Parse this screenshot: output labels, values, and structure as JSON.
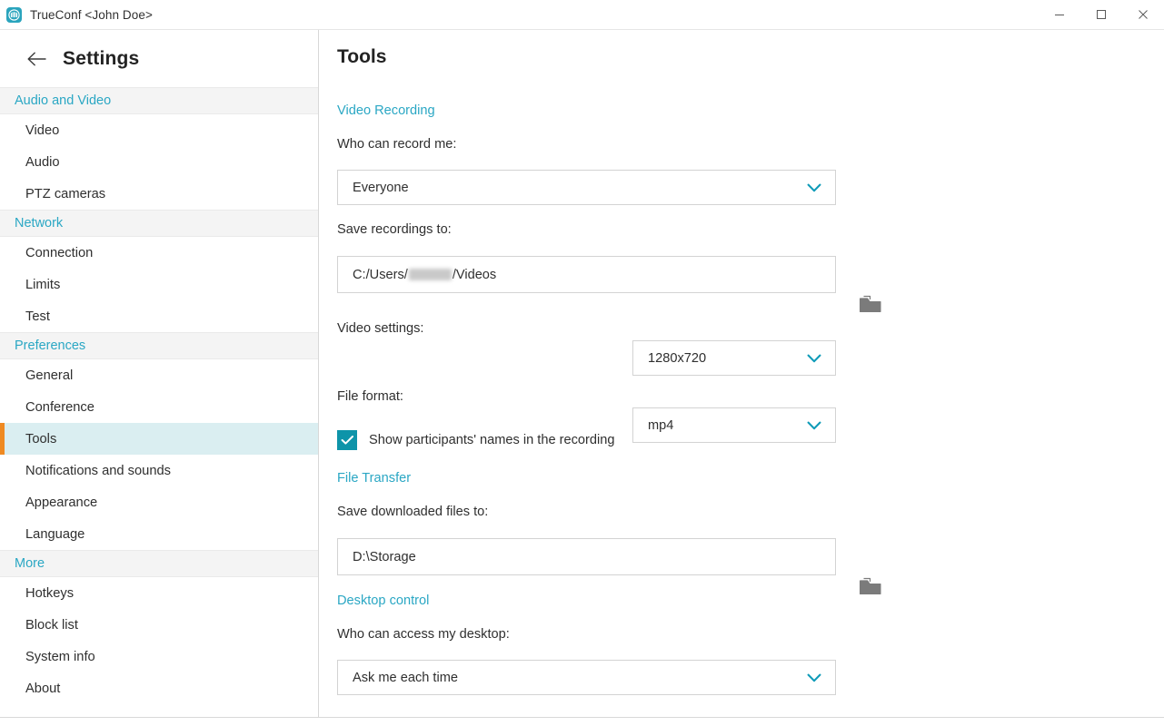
{
  "window": {
    "title": "TrueConf <John Doe>",
    "app_icon": "trueconf-logo-icon",
    "controls": {
      "minimize": "minimize-button",
      "maximize": "maximize-button",
      "close": "close-button"
    }
  },
  "sidebar": {
    "back_label": "back-arrow",
    "title": "Settings",
    "groups": [
      {
        "header": "Audio and Video",
        "items": [
          {
            "label": "Video",
            "selected": false
          },
          {
            "label": "Audio",
            "selected": false
          },
          {
            "label": "PTZ cameras",
            "selected": false
          }
        ]
      },
      {
        "header": "Network",
        "items": [
          {
            "label": "Connection",
            "selected": false
          },
          {
            "label": "Limits",
            "selected": false
          },
          {
            "label": "Test",
            "selected": false
          }
        ]
      },
      {
        "header": "Preferences",
        "items": [
          {
            "label": "General",
            "selected": false
          },
          {
            "label": "Conference",
            "selected": false
          },
          {
            "label": "Tools",
            "selected": true
          },
          {
            "label": "Notifications and sounds",
            "selected": false
          },
          {
            "label": "Appearance",
            "selected": false
          },
          {
            "label": "Language",
            "selected": false
          }
        ]
      },
      {
        "header": "More",
        "items": [
          {
            "label": "Hotkeys",
            "selected": false
          },
          {
            "label": "Block list",
            "selected": false
          },
          {
            "label": "System info",
            "selected": false
          },
          {
            "label": "About",
            "selected": false
          }
        ]
      }
    ]
  },
  "main": {
    "page_title": "Tools",
    "video_recording": {
      "section_title": "Video Recording",
      "who_can_record_label": "Who can record me:",
      "who_can_record_value": "Everyone",
      "save_recordings_label": "Save recordings to:",
      "save_recordings_path_prefix": "C:/Users/",
      "save_recordings_path_suffix": "/Videos",
      "save_recordings_redacted": true,
      "video_settings_label": "Video settings:",
      "video_settings_value": "1280x720",
      "file_format_label": "File format:",
      "file_format_value": "mp4",
      "show_names_checkbox_label": "Show participants' names in the recording",
      "show_names_checked": true
    },
    "file_transfer": {
      "section_title": "File Transfer",
      "save_downloads_label": "Save downloaded files to:",
      "save_downloads_value": "D:\\Storage"
    },
    "desktop_control": {
      "section_title": "Desktop control",
      "who_can_access_label": "Who can access my desktop:",
      "who_can_access_value": "Ask me each time"
    }
  },
  "colors": {
    "accent_teal": "#2aa7c4",
    "selected_row_bg": "#daeef1",
    "selected_marker_orange": "#ef8a22",
    "checkbox_teal": "#0e94a9",
    "group_header_bg": "#f4f4f4",
    "border_gray": "#d3d3d3"
  }
}
